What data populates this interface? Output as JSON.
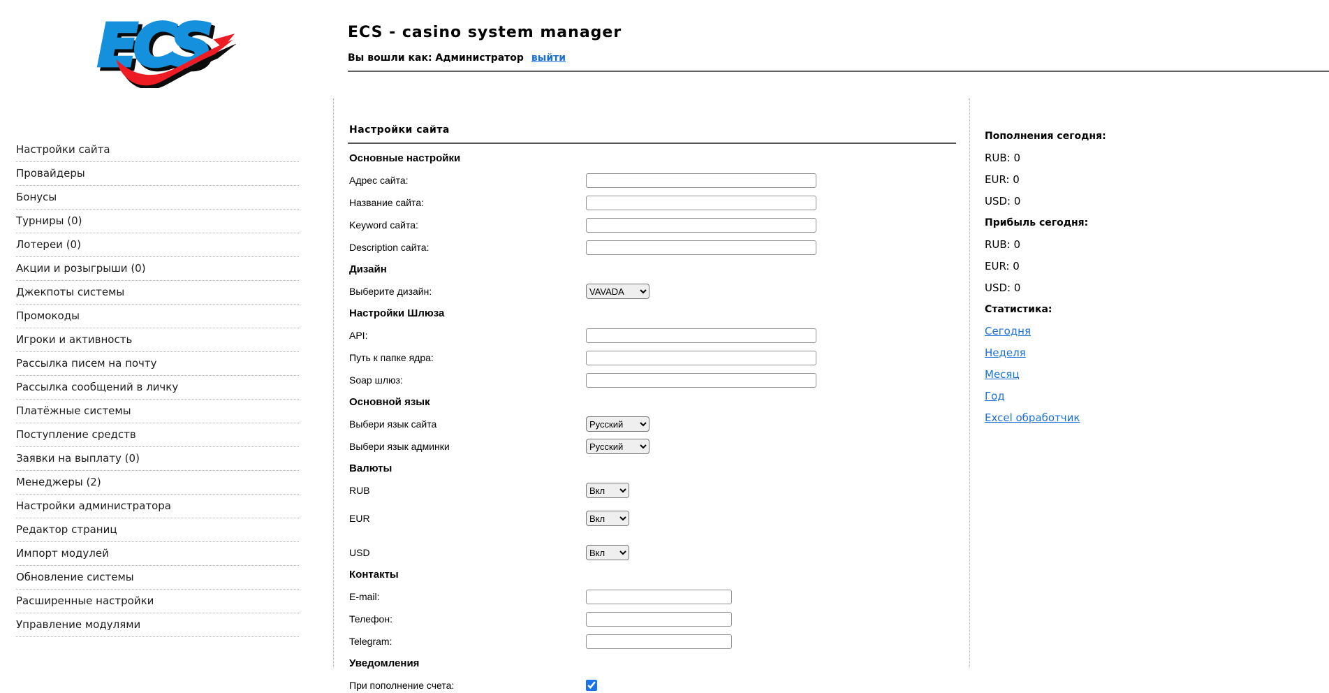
{
  "colors": {
    "link_blue": "#1a70db",
    "logo_blue": "#1590dc",
    "logo_red": "#ed1c24",
    "checkbox_blue": "#1a73e8"
  },
  "header": {
    "logo_text": "ECS",
    "title": "ECS - casino system manager",
    "login_text": "Вы вошли как: Администратор",
    "logout_link": "выйти"
  },
  "sidebar": {
    "items": [
      {
        "label": "Настройки сайта"
      },
      {
        "label": "Провайдеры"
      },
      {
        "label": "Бонусы"
      },
      {
        "label": "Турниры (0)"
      },
      {
        "label": "Лотереи (0)"
      },
      {
        "label": "Акции и розыгрыши (0)"
      },
      {
        "label": "Джекпоты системы"
      },
      {
        "label": "Промокоды"
      },
      {
        "label": "Игроки и активность"
      },
      {
        "label": "Рассылка писем на почту"
      },
      {
        "label": "Рассылка сообщений в личку"
      },
      {
        "label": "Платёжные системы"
      },
      {
        "label": "Поступление средств"
      },
      {
        "label": "Заявки на выплату (0)"
      },
      {
        "label": "Менеджеры (2)"
      },
      {
        "label": "Настройки администратора"
      },
      {
        "label": "Редактор страниц"
      },
      {
        "label": "Импорт модулей"
      },
      {
        "label": "Обновление системы"
      },
      {
        "label": "Расширенные настройки"
      },
      {
        "label": "Управление модулями"
      }
    ]
  },
  "main": {
    "title": "Настройки сайта",
    "sections": {
      "basic": "Основные настройки",
      "design": "Дизайн",
      "gateway": "Настройки Шлюза",
      "language": "Основной язык",
      "currencies": "Валюты",
      "contacts": "Контакты",
      "notifications": "Уведомления"
    },
    "fields": {
      "site_address": {
        "label": "Адрес сайта:",
        "value": ""
      },
      "site_name": {
        "label": "Название сайта:",
        "value": ""
      },
      "site_keyword": {
        "label": "Keyword сайта:",
        "value": ""
      },
      "site_description": {
        "label": "Description сайта:",
        "value": ""
      },
      "design_select": {
        "label": "Выберите дизайн:",
        "value": "VAVADA"
      },
      "api": {
        "label": "API:",
        "value": ""
      },
      "core_path": {
        "label": "Путь к папке ядра:",
        "value": ""
      },
      "soap": {
        "label": "Soap шлюз:",
        "value": ""
      },
      "site_lang": {
        "label": "Выбери язык сайта",
        "value": "Русский"
      },
      "admin_lang": {
        "label": "Выбери язык админки",
        "value": "Русский"
      },
      "rub": {
        "label": "RUB",
        "value": "Вкл"
      },
      "eur": {
        "label": "EUR",
        "value": "Вкл"
      },
      "usd": {
        "label": "USD",
        "value": "Вкл"
      },
      "email": {
        "label": "E-mail:",
        "value": ""
      },
      "phone": {
        "label": "Телефон:",
        "value": ""
      },
      "telegram": {
        "label": "Telegram:",
        "value": ""
      },
      "deposit_notice": {
        "label": "При пополнение счета:",
        "checked": true
      }
    }
  },
  "stats": {
    "deposits_title": "Пополнения сегодня:",
    "deposits": [
      "RUB: 0",
      "EUR: 0",
      "USD: 0"
    ],
    "profit_title": "Прибыль сегодня:",
    "profit": [
      "RUB: 0",
      "EUR: 0",
      "USD: 0"
    ],
    "stats_title": "Статистика:",
    "links": [
      "Сегодня",
      "Неделя",
      "Месяц",
      "Год",
      "Excel обработчик"
    ]
  }
}
